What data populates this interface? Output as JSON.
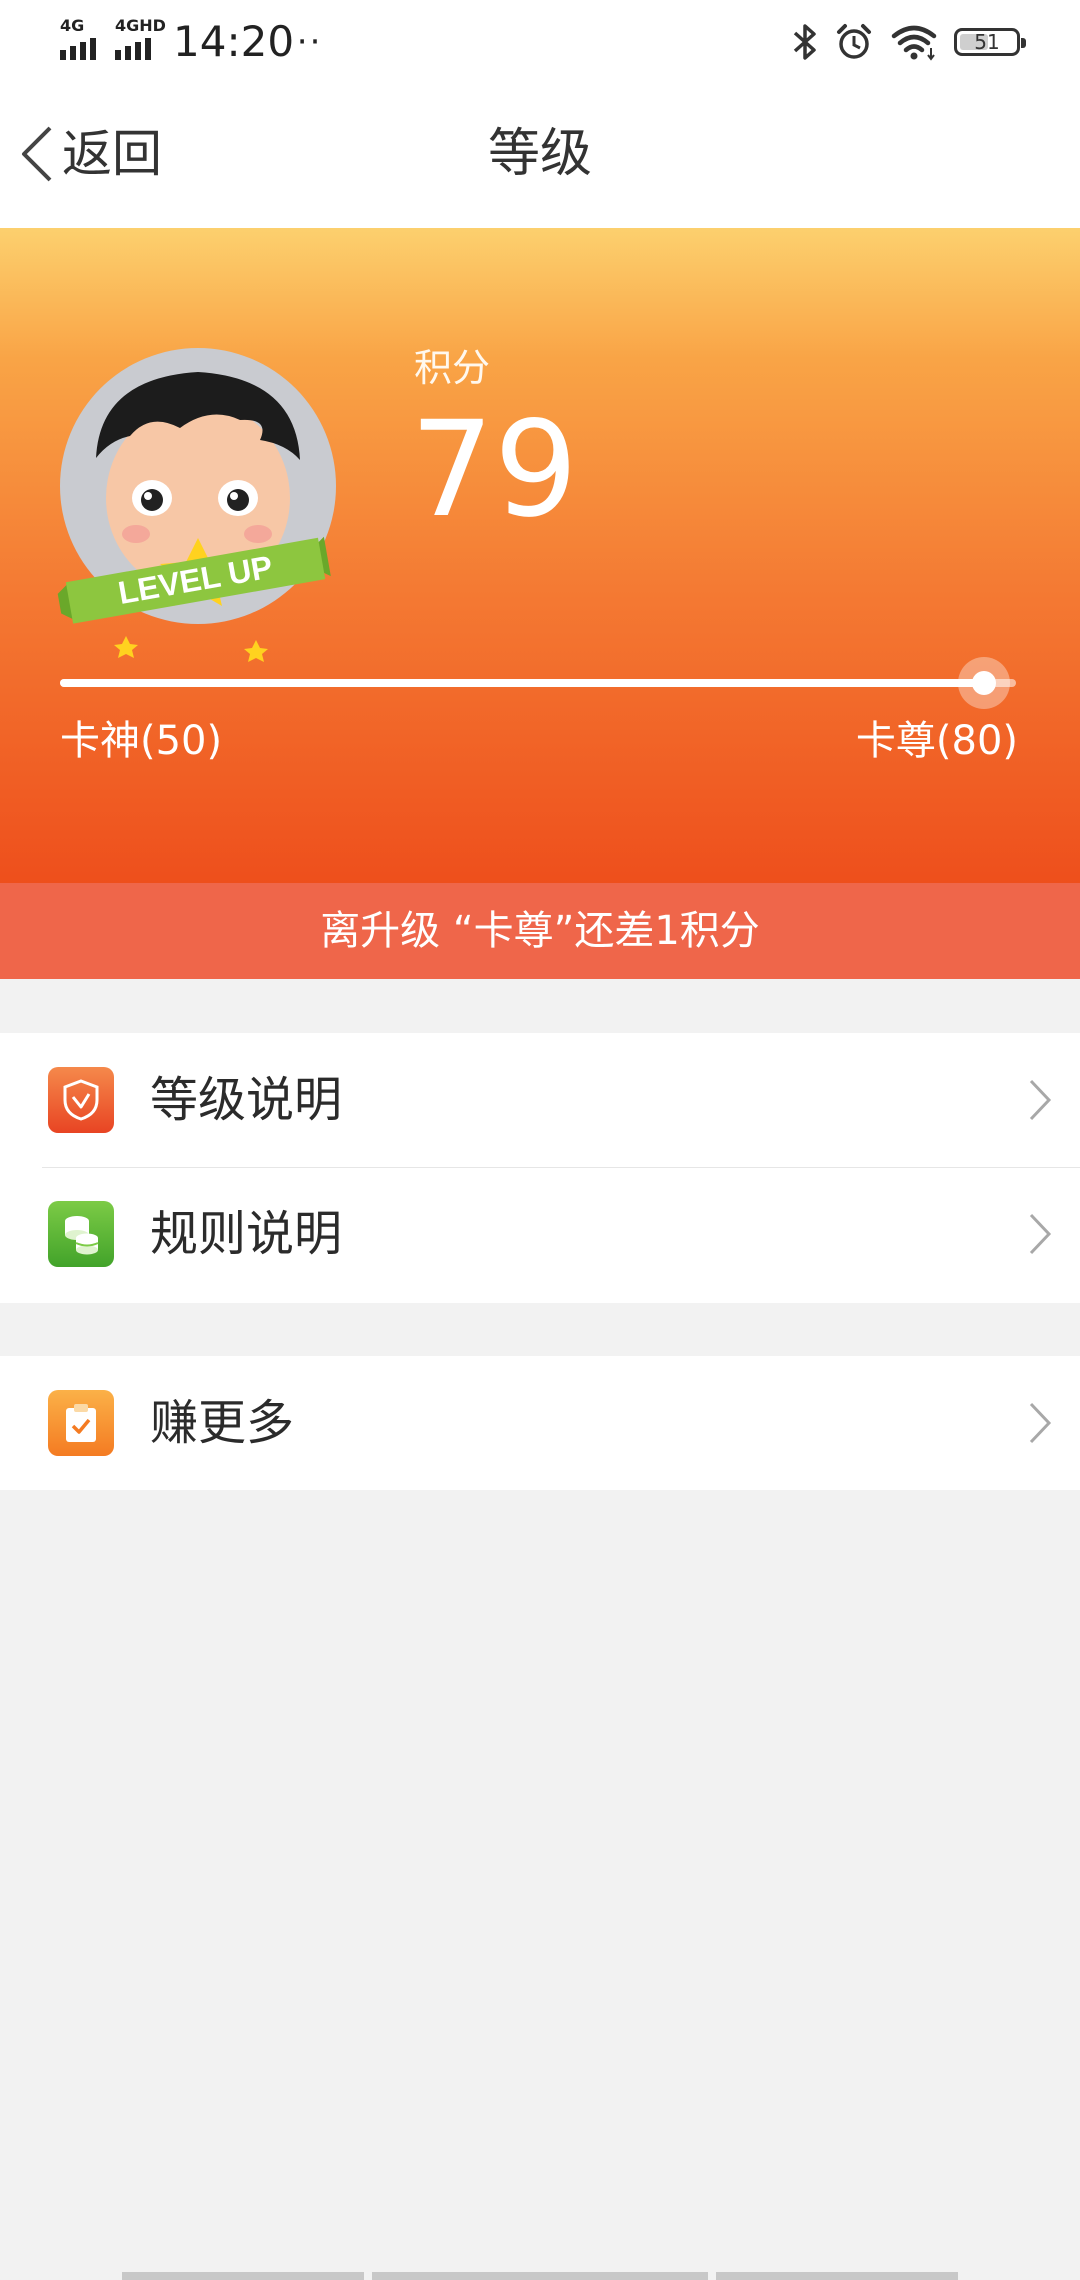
{
  "status_bar": {
    "signal_1": "4G",
    "signal_2": "4GHD",
    "time": "14:20",
    "more": "···",
    "icons": [
      "bluetooth-icon",
      "alarm-icon",
      "wifi-icon",
      "battery-icon"
    ],
    "battery": "51"
  },
  "nav": {
    "back_label": "返回",
    "title": "等级"
  },
  "hero": {
    "avatar_badge": "LEVEL UP",
    "points_label": "积分",
    "points_value": "79",
    "progress_fraction": 0.967,
    "level_current": "卡神(50)",
    "level_next": "卡尊(80)",
    "upgrade_message": "离升级 “卡尊”还差1积分"
  },
  "menu": {
    "group1": [
      {
        "label": "等级说明",
        "icon": "shield-check-icon"
      },
      {
        "label": "规则说明",
        "icon": "coin-stack-icon"
      }
    ],
    "group2": [
      {
        "label": "赚更多",
        "icon": "clipboard-check-icon"
      }
    ]
  },
  "colors": {
    "hero_top": "#fcd06e",
    "hero_bottom": "#ee4f1c",
    "banner": "#ef664a",
    "background": "#f2f2f2"
  }
}
